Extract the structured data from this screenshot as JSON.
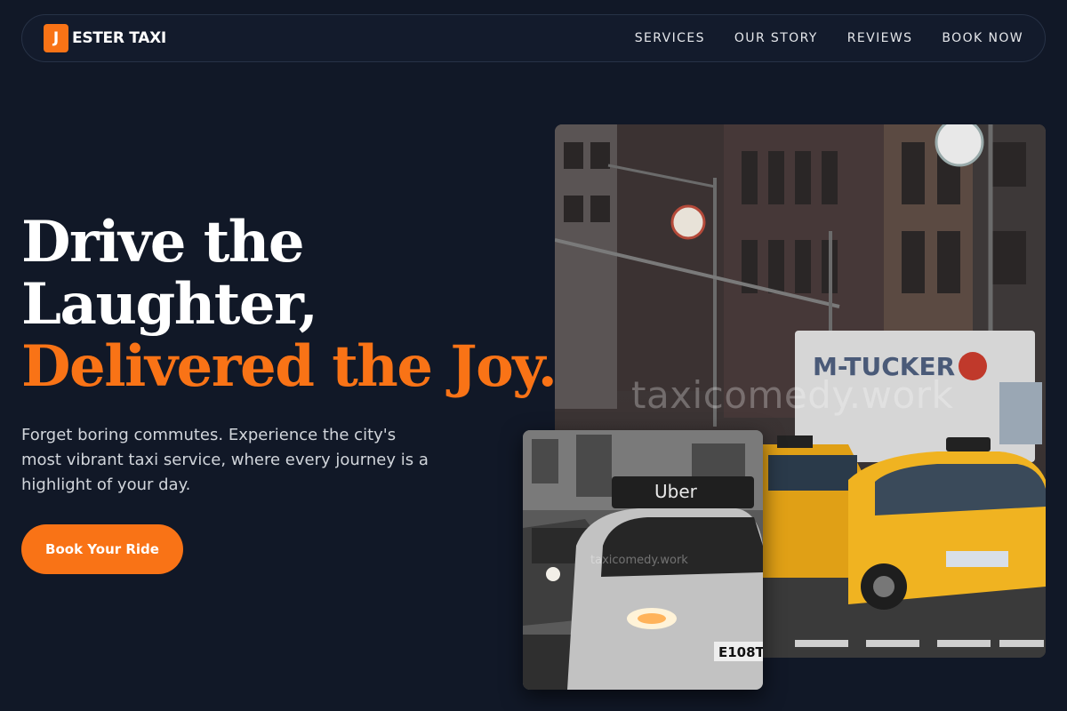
{
  "brand": {
    "mark": "J",
    "name": "ESTER TAXI"
  },
  "nav": {
    "links": [
      "SERVICES",
      "OUR STORY",
      "REVIEWS",
      "BOOK NOW"
    ]
  },
  "hero": {
    "headline_line1": "Drive the",
    "headline_line2": "Laughter,",
    "headline_line3": "Delivered the Joy.",
    "lead": "Forget boring commutes. Experience the city's most vibrant taxi service, where every journey is a highlight of your day.",
    "cta_label": "Book Your Ride"
  },
  "images": {
    "main_watermark": "taxicomedy.work",
    "inset_watermark": "taxicomedy.work",
    "main_truck_text": "M-TUCKER",
    "inset_roof_sign": "Uber",
    "inset_plate": "E108T"
  },
  "colors": {
    "background": "#111827",
    "accent": "#f97316",
    "text": "#ffffff",
    "muted": "#d1d5db"
  }
}
